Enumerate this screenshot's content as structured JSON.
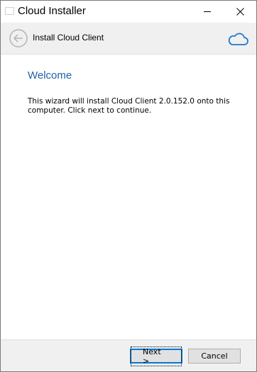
{
  "window": {
    "title": "Cloud Installer",
    "minimize_icon": "minimize-icon",
    "close_icon": "close-icon"
  },
  "header": {
    "back_icon": "back-arrow-icon",
    "title": "Install Cloud Client",
    "logo_icon": "cloud-icon",
    "accent_color": "#1e78c8"
  },
  "content": {
    "heading": "Welcome",
    "heading_color": "#1e63a8",
    "message": "This wizard will install Cloud Client 2.0.152.0 onto this computer. Click next to continue."
  },
  "footer": {
    "next_label": "Next >",
    "cancel_label": "Cancel"
  }
}
